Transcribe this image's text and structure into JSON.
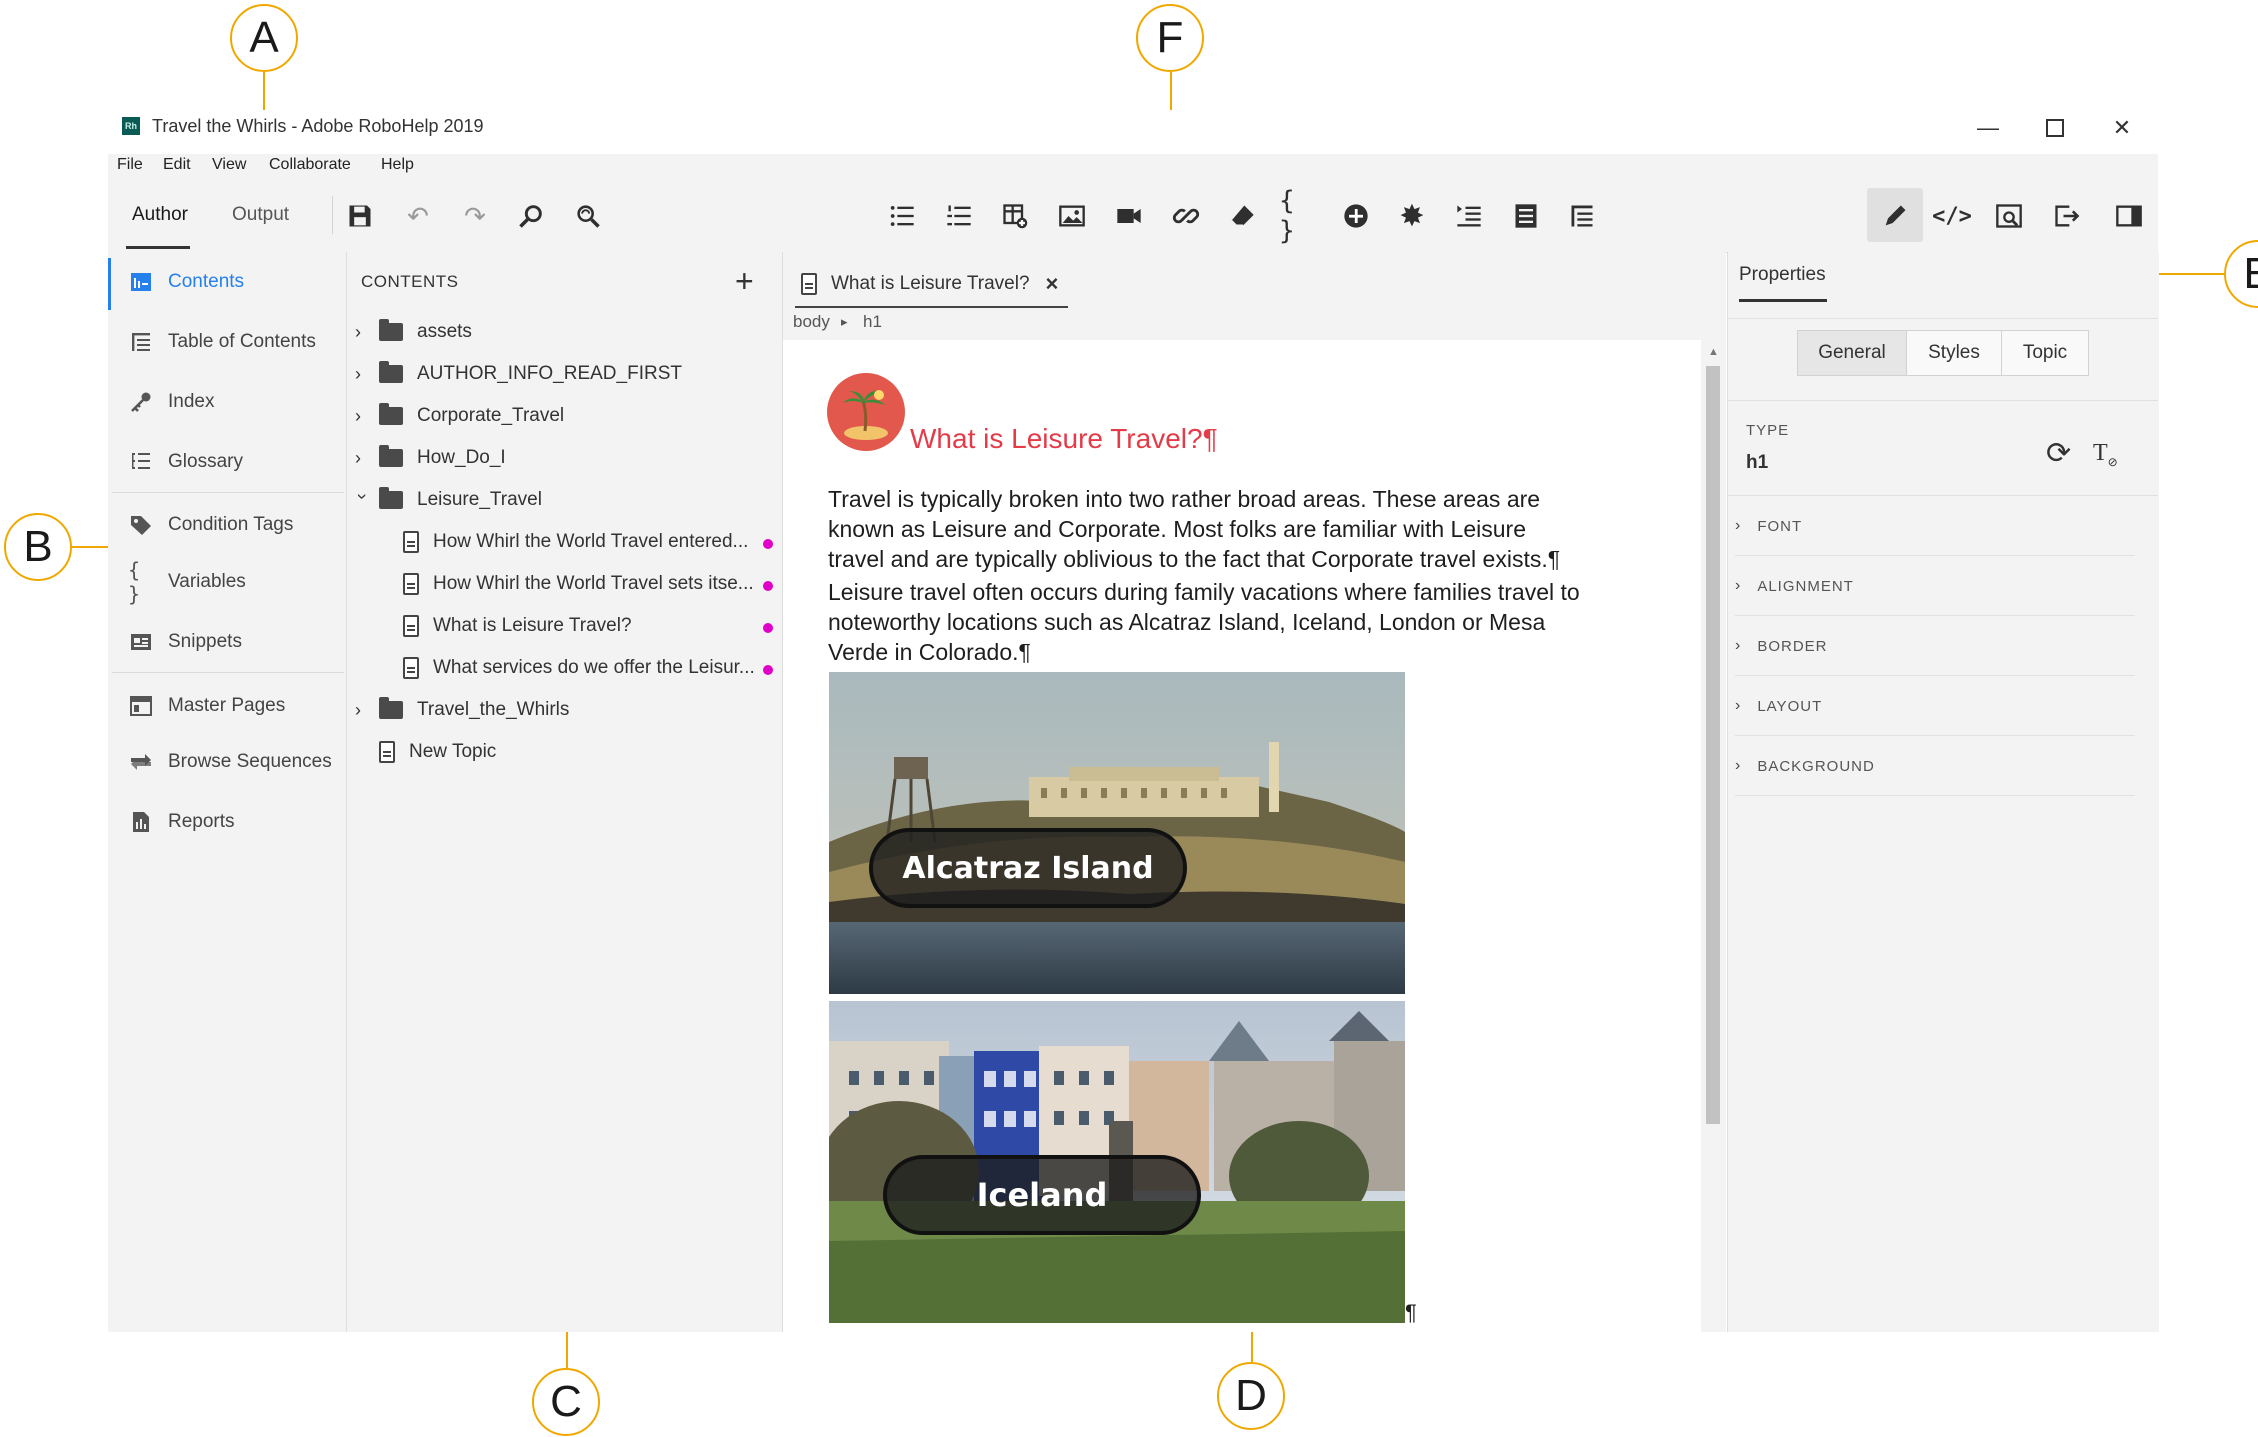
{
  "callouts": [
    "A",
    "B",
    "C",
    "D",
    "E",
    "F"
  ],
  "window": {
    "app_icon": "Rh",
    "title": "Travel the Whirls - Adobe RoboHelp 2019",
    "controls": [
      "minimize-icon",
      "maximize-icon",
      "close-icon"
    ]
  },
  "menu": [
    "File",
    "Edit",
    "View",
    "Collaborate",
    "Help"
  ],
  "toolbar": {
    "modes": [
      "Author",
      "Output"
    ],
    "active_mode": "Author",
    "left_icons": [
      "save-icon",
      "undo-icon",
      "redo-icon",
      "find-icon",
      "find-replace-icon"
    ],
    "insert_icons": [
      "bulleted-list-icon",
      "numbered-list-icon",
      "insert-table-icon",
      "insert-image-icon",
      "insert-video-icon",
      "hyperlink-icon",
      "eraser-icon",
      "variable-braces-icon",
      "insert-symbol-icon",
      "asterisk-icon",
      "dropdown-text-icon",
      "snippet-icon",
      "toc-list-icon"
    ],
    "right_icons": [
      "author-view-icon",
      "source-view-icon",
      "preview-icon",
      "publish-icon",
      "panel-toggle-icon"
    ]
  },
  "leftnav": [
    {
      "label": "Contents",
      "icon": "contents-icon",
      "active": true
    },
    {
      "label": "Table of Contents",
      "icon": "toc-icon"
    },
    {
      "label": "Index",
      "icon": "key-icon"
    },
    {
      "label": "Glossary",
      "icon": "glossary-icon"
    },
    {
      "label": "Condition Tags",
      "icon": "tag-icon"
    },
    {
      "label": "Variables",
      "icon": "braces-icon"
    },
    {
      "label": "Snippets",
      "icon": "snippet-icon"
    },
    {
      "label": "Master Pages",
      "icon": "master-page-icon"
    },
    {
      "label": "Browse Sequences",
      "icon": "browse-sequence-icon"
    },
    {
      "label": "Reports",
      "icon": "reports-icon"
    }
  ],
  "contents": {
    "header": "CONTENTS",
    "add_symbol": "+",
    "tree": [
      {
        "label": "assets",
        "type": "folder",
        "expanded": false
      },
      {
        "label": "AUTHOR_INFO_READ_FIRST",
        "type": "folder",
        "expanded": false
      },
      {
        "label": "Corporate_Travel",
        "type": "folder",
        "expanded": false
      },
      {
        "label": "How_Do_I",
        "type": "folder",
        "expanded": false
      },
      {
        "label": "Leisure_Travel",
        "type": "folder",
        "expanded": true
      },
      {
        "label": "How Whirl the World Travel entered...",
        "type": "topic",
        "indent": 1,
        "modified": true
      },
      {
        "label": "How Whirl the World Travel sets itse...",
        "type": "topic",
        "indent": 1,
        "modified": true
      },
      {
        "label": "What is Leisure Travel?",
        "type": "topic",
        "indent": 1,
        "modified": true
      },
      {
        "label": "What services do we offer the Leisur...",
        "type": "topic",
        "indent": 1,
        "modified": true
      },
      {
        "label": "Travel_the_Whirls",
        "type": "folder",
        "expanded": false
      },
      {
        "label": "New Topic",
        "type": "topic",
        "indent": 0
      }
    ],
    "modified_color": "#e000c8"
  },
  "editor": {
    "tab_title": "What is Leisure Travel?",
    "tab_close": "×",
    "breadcrumb": [
      "body",
      "h1"
    ],
    "breadcrumb_sep": "▸",
    "heading": "What is Leisure Travel?¶",
    "heading_color": "#e33b48",
    "paragraph_1": [
      "Travel is typically broken into two rather broad areas. These areas are",
      "known as Leisure and Corporate. Most folks are familiar with Leisure",
      "travel and are typically oblivious to the fact that Corporate travel exists.¶"
    ],
    "paragraph_2": [
      "Leisure travel often occurs during family vacations where families travel to",
      "noteworthy locations such as Alcatraz Island, Iceland, London or Mesa",
      "Verde in Colorado.¶"
    ],
    "images": [
      {
        "caption": "Alcatraz Island"
      },
      {
        "caption": "Iceland"
      }
    ],
    "trailing_mark": "¶"
  },
  "properties": {
    "tab": "Properties",
    "segments": [
      "General",
      "Styles",
      "Topic"
    ],
    "active_segment": "General",
    "type_label": "TYPE",
    "type_value": "h1",
    "sections": [
      "FONT",
      "ALIGNMENT",
      "BORDER",
      "LAYOUT",
      "BACKGROUND"
    ]
  }
}
